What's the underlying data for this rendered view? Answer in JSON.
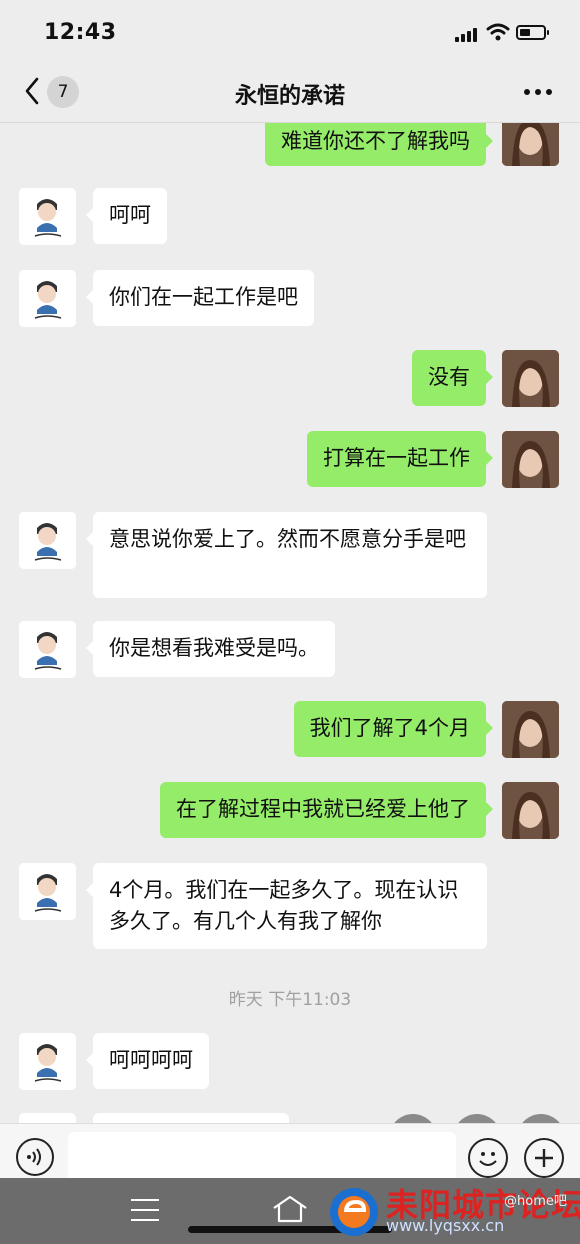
{
  "status_bar": {
    "time": "12:43"
  },
  "header": {
    "unread_count": "7",
    "title": "永恒的承诺"
  },
  "messages": [
    {
      "side": "me",
      "text": "难道你还不了解我吗"
    },
    {
      "side": "other",
      "text": "呵呵"
    },
    {
      "side": "other",
      "text": "你们在一起工作是吧"
    },
    {
      "side": "me",
      "text": "没有"
    },
    {
      "side": "me",
      "text": "打算在一起工作"
    },
    {
      "side": "other",
      "text": "意思说你爱上了。然而不愿意分手是吧"
    },
    {
      "side": "other",
      "text": "你是想看我难受是吗。"
    },
    {
      "side": "me",
      "text": "我们了解了4个月"
    },
    {
      "side": "me",
      "text": "在了解过程中我就已经爱上他了"
    },
    {
      "side": "other",
      "text": "4个月。我们在一起多久了。现在认识多久了。有几个人有我了解你"
    },
    {
      "side": "timestamp",
      "text": "昨天 下午11:03"
    },
    {
      "side": "other",
      "text": "呵呵呵呵"
    }
  ],
  "icons": {
    "back": "chevron-left-icon",
    "more": "more-dots-icon",
    "voice": "voice-icon",
    "emoji": "emoji-icon",
    "plus": "plus-icon",
    "download": "download-icon",
    "grid": "grid-icon",
    "menu": "menu-icon",
    "home": "home-icon"
  },
  "watermark": {
    "text": "耒阳城市论坛",
    "url": "www.lyqsxx.cn",
    "tag": "@home吧"
  },
  "colors": {
    "my_bubble": "#95ec69",
    "other_bubble": "#ffffff",
    "chat_bg": "#ededed"
  }
}
